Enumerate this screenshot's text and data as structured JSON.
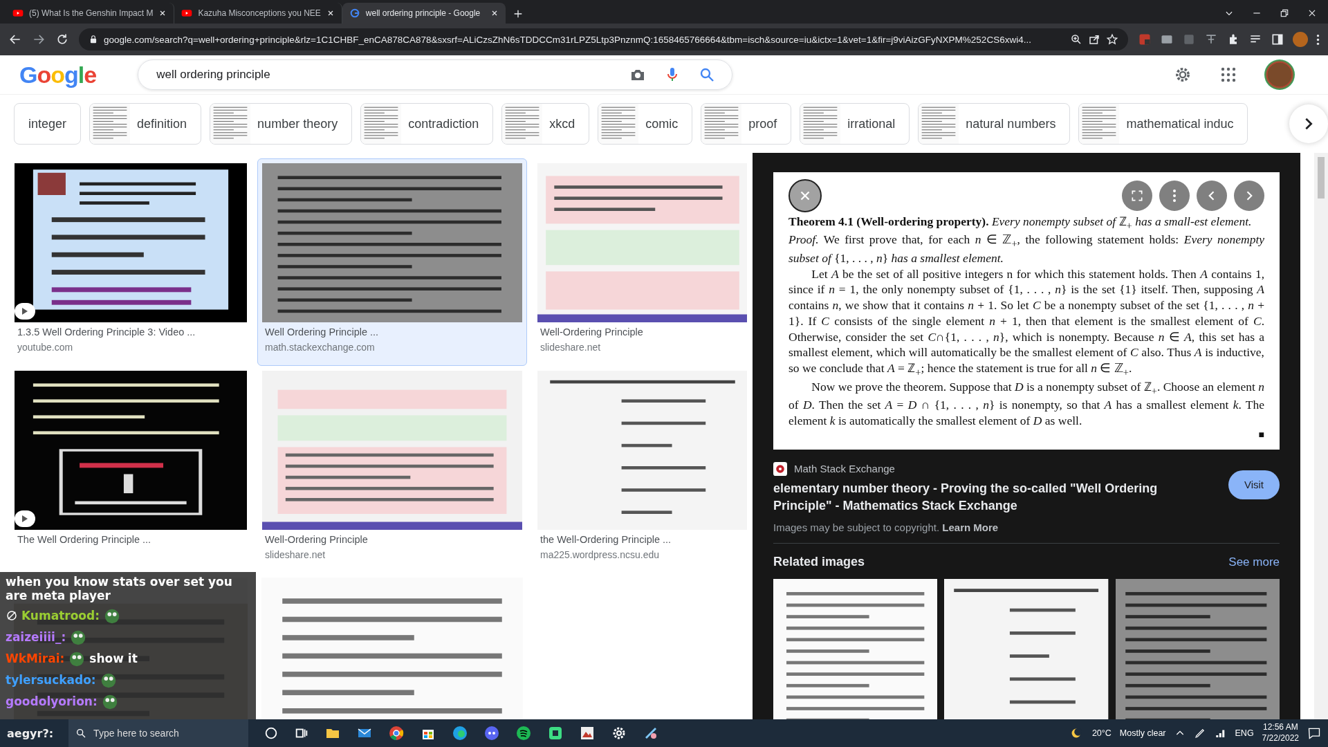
{
  "browser": {
    "tabs": [
      {
        "title": "(5) What Is the Genshin Impact M",
        "kind": "video",
        "selected": false
      },
      {
        "title": "Kazuha Misconceptions you NEE",
        "kind": "video",
        "selected": false
      },
      {
        "title": "well ordering principle - Google",
        "kind": "search",
        "selected": true
      }
    ],
    "url": "google.com/search?q=well+ordering+principle&rlz=1C1CHBF_enCA878CA878&sxsrf=ALiCzsZhN6sTDDCCm31rLPZ5Ltp3PnznmQ:1658465766664&tbm=isch&source=iu&ictx=1&vet=1&fir=j9viAizGFyNXPM%252CS6xwi4..."
  },
  "header": {
    "logo": "Google",
    "search": {
      "value": "well ordering principle"
    }
  },
  "chips": [
    {
      "label": "integer",
      "thumbnail": false
    },
    {
      "label": "definition",
      "thumbnail": true
    },
    {
      "label": "number theory",
      "thumbnail": true
    },
    {
      "label": "contradiction",
      "thumbnail": true
    },
    {
      "label": "xkcd",
      "thumbnail": true
    },
    {
      "label": "comic",
      "thumbnail": true
    },
    {
      "label": "proof",
      "thumbnail": true
    },
    {
      "label": "irrational",
      "thumbnail": true
    },
    {
      "label": "natural numbers",
      "thumbnail": true
    },
    {
      "label": "mathematical induc",
      "thumbnail": true
    }
  ],
  "results": [
    {
      "kind": "result",
      "title": "1.3.5 Well Ordering Principle 3: Video ...",
      "source": "youtube.com",
      "video": true,
      "selected": false
    },
    {
      "kind": "result",
      "title": "Well Ordering Principle ...",
      "source": "math.stackexchange.com",
      "video": false,
      "selected": true
    },
    {
      "kind": "result",
      "title": "Well-Ordering Principle",
      "source": "slideshare.net",
      "video": false,
      "selected": false
    },
    {
      "kind": "result",
      "title": "The Well Ordering Principle ...",
      "video": true,
      "selected": false
    },
    {
      "kind": "result",
      "title": "Well-Ordering Principle",
      "source": "slideshare.net",
      "video": false,
      "selected": false
    },
    {
      "kind": "result",
      "title": "the Well-Ordering Principle ...",
      "source": "ma225.wordpress.ncsu.edu",
      "video": false,
      "selected": false
    },
    {
      "kind": "picture"
    },
    {
      "kind": "picture"
    }
  ],
  "preview": {
    "theorem": "**Theorem 4.1 (Well-ordering property).** *Every nonempty subset of* ℤ$_{+}$ *has a small-est element.*",
    "paragraphs": [
      "*Proof.* We first prove that, for each *n* ∈ ℤ$_{+}$, the following statement holds: *Every nonempty subset of* {1, . . . , *n*} *has a smallest element.*",
      "Let *A* be the set of all positive integers n for which this statement holds. Then *A* contains 1, since if *n* = 1, the only nonempty subset of {1, . . . , *n*} is the set {1} itself. Then, supposing *A* contains *n*, we show that it contains *n* + 1. So let *C* be a nonempty subset of the set {1, . . . , *n* + 1}. If *C* consists of the single element *n* + 1, then that element is the smallest element of *C*. Otherwise, consider the set *C*∩{1, . . . , *n*}, which is nonempty. Because *n* ∈ *A*, this set has a smallest element, which will automatically be the smallest element of *C* also. Thus *A* is inductive, so we conclude that *A* = ℤ$_{+}$; hence the statement is true for all *n* ∈ ℤ$_{+}$.",
      "Now we prove the theorem. Suppose that *D* is a nonempty subset of ℤ$_{+}$. Choose an element *n* of *D*. Then the set *A* = *D* ∩ {1, . . . , *n*} is nonempty, so that *A* has a smallest element *k*. The element *k* is automatically the smallest element of *D* as well."
    ],
    "qed": "■",
    "source": "Math Stack Exchange",
    "title": "elementary number theory - Proving the so-called \"Well Ordering Principle\" - Mathematics Stack Exchange",
    "visit": "Visit",
    "copyright": "Images may be subject to copyright.",
    "learn_more": "Learn More",
    "related_heading": "Related images",
    "see_more": "See more"
  },
  "chat": [
    {
      "text": "when you know stats over set you are meta player"
    },
    {
      "user": "Kumatrood:",
      "color": "#9acd32",
      "badge": true,
      "emote": true
    },
    {
      "user": "zaizeiiii_:",
      "color": "#b57aff",
      "badge": false,
      "emote": true
    },
    {
      "user": "WkMirai:",
      "color": "#ff4500",
      "badge": false,
      "emote": true,
      "text": "show it"
    },
    {
      "user": "tylersuckado:",
      "color": "#3fa0ff",
      "badge": false,
      "emote": true
    },
    {
      "user": "goodolyorion:",
      "color": "#b57aff",
      "badge": false,
      "emote": true
    }
  ],
  "taskbar": {
    "chat_user": "aegyr?:",
    "search_placeholder": "Type here to search",
    "temperature": "20°C",
    "weather": "Mostly clear",
    "language": "ENG",
    "time": "12:56 AM",
    "date": "7/22/2022"
  }
}
